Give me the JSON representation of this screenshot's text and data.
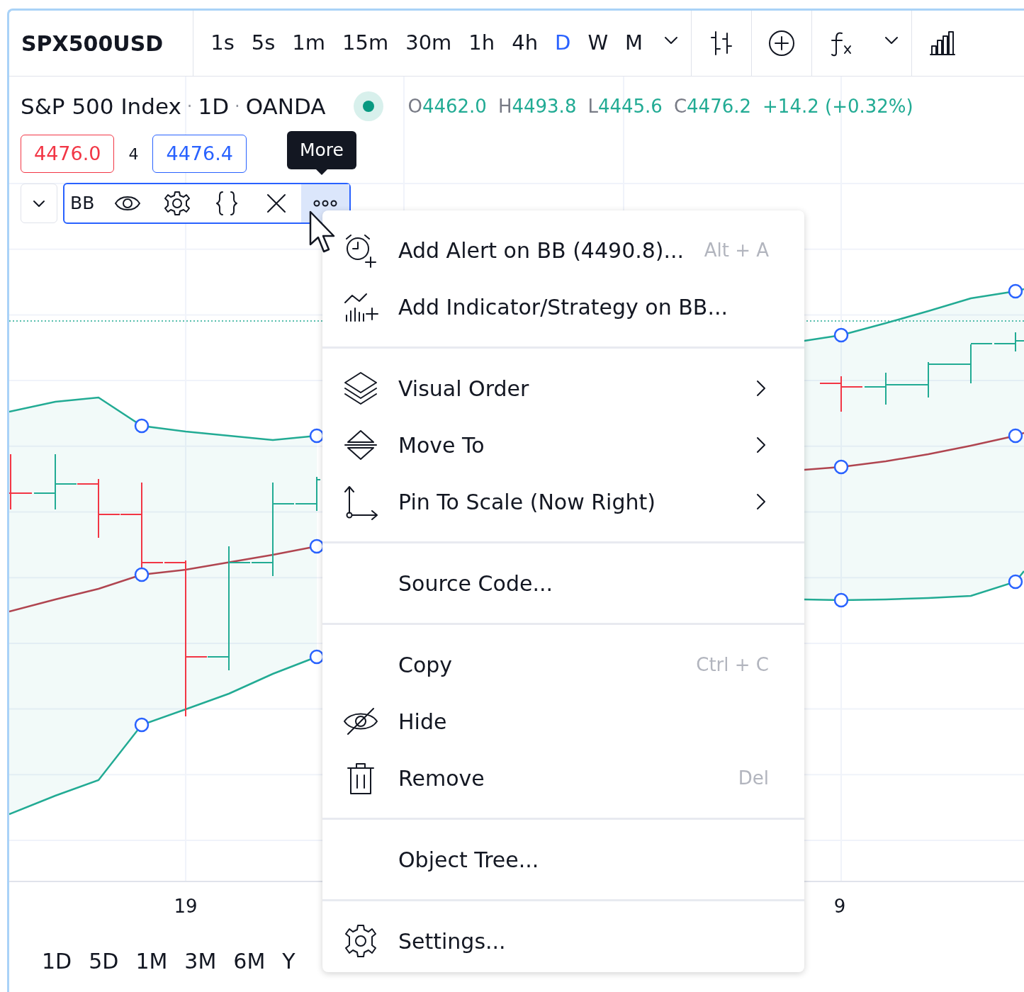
{
  "toolbar": {
    "symbol": "SPX500USD",
    "intervals": [
      {
        "label": "1s",
        "selected": false
      },
      {
        "label": "5s",
        "selected": false
      },
      {
        "label": "1m",
        "selected": false
      },
      {
        "label": "15m",
        "selected": false
      },
      {
        "label": "30m",
        "selected": false
      },
      {
        "label": "1h",
        "selected": false
      },
      {
        "label": "4h",
        "selected": false
      },
      {
        "label": "D",
        "selected": true
      },
      {
        "label": "W",
        "selected": false
      },
      {
        "label": "M",
        "selected": false
      }
    ]
  },
  "legend": {
    "title_parts": [
      {
        "kind": "text",
        "text": "S&P 500 Index"
      },
      {
        "kind": "sep",
        "text": "·"
      },
      {
        "kind": "text",
        "text": "1D"
      },
      {
        "kind": "sep",
        "text": "·"
      },
      {
        "kind": "text",
        "text": "OANDA"
      }
    ],
    "market_open": true,
    "ohlc": [
      {
        "label": "O",
        "value": "4462.0"
      },
      {
        "label": "H",
        "value": "4493.8"
      },
      {
        "label": "L",
        "value": "4445.6"
      },
      {
        "label": "C",
        "value": "4476.2"
      }
    ],
    "change": "+14.2 (+0.32%)"
  },
  "quote": {
    "bid": "4476.0",
    "spread": "4",
    "ask": "4476.4"
  },
  "tooltip": "More",
  "indicator": {
    "name": "BB",
    "visible": true
  },
  "menu": {
    "sections": [
      [
        {
          "label": "Add Alert on BB (4490.8)...",
          "shortcut": "Alt + A",
          "submenu": false
        },
        {
          "label": "Add Indicator/Strategy on BB...",
          "submenu": false
        }
      ],
      [
        {
          "label": "Visual Order",
          "submenu": true
        },
        {
          "label": "Move To",
          "submenu": true
        },
        {
          "label": "Pin To Scale (Now Right)",
          "submenu": true
        }
      ],
      [
        {
          "label": "Source Code...",
          "submenu": false
        }
      ],
      [
        {
          "label": "Copy",
          "shortcut": "Ctrl + C",
          "submenu": false
        },
        {
          "label": "Hide",
          "submenu": false
        },
        {
          "label": "Remove",
          "shortcut": "Del",
          "submenu": false
        }
      ],
      [
        {
          "label": "Object Tree...",
          "submenu": false
        }
      ],
      [
        {
          "label": "Settings...",
          "submenu": false
        }
      ]
    ]
  },
  "x_axis": [
    "19",
    "9"
  ],
  "ranges": [
    "1D",
    "5D",
    "1M",
    "3M",
    "6M",
    "Y"
  ]
}
